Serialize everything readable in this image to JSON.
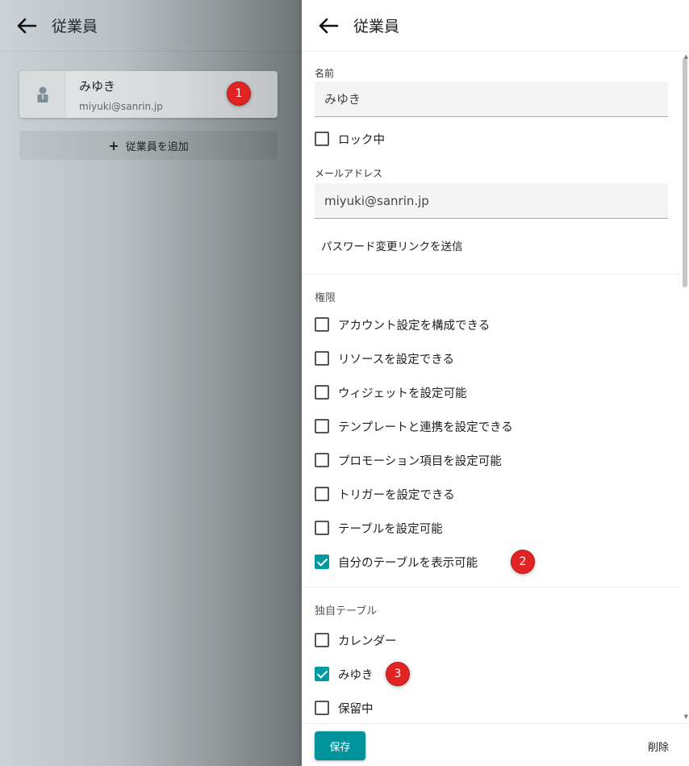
{
  "left": {
    "title": "従業員",
    "employees": [
      {
        "name": "みゆき",
        "email": "miyuki@sanrin.jp"
      }
    ],
    "add_label": "従業員を追加"
  },
  "right": {
    "title": "従業員",
    "name_label": "名前",
    "name_value": "みゆき",
    "locked_label": "ロック中",
    "locked": false,
    "email_label": "メールアドレス",
    "email_value": "miyuki@sanrin.jp",
    "password_link": "パスワード変更リンクを送信",
    "permissions_label": "権限",
    "permissions": [
      {
        "label": "アカウント設定を構成できる",
        "checked": false
      },
      {
        "label": "リソースを設定できる",
        "checked": false
      },
      {
        "label": "ウィジェットを設定可能",
        "checked": false
      },
      {
        "label": "テンプレートと連携を設定できる",
        "checked": false
      },
      {
        "label": "プロモーション項目を設定可能",
        "checked": false
      },
      {
        "label": "トリガーを設定できる",
        "checked": false
      },
      {
        "label": "テーブルを設定可能",
        "checked": false
      },
      {
        "label": "自分のテーブルを表示可能",
        "checked": true
      }
    ],
    "custom_tables_label": "独自テーブル",
    "custom_tables": [
      {
        "label": "カレンダー",
        "checked": false
      },
      {
        "label": "みゆき",
        "checked": true
      },
      {
        "label": "保留中",
        "checked": false
      }
    ],
    "save_label": "保存",
    "delete_label": "削除"
  },
  "badges": [
    "1",
    "2",
    "3"
  ],
  "colors": {
    "accent": "#009aa0",
    "badge": "#e02424"
  },
  "icons": {
    "back": "arrow-left-icon",
    "avatar": "person-icon",
    "add": "plus-icon"
  }
}
